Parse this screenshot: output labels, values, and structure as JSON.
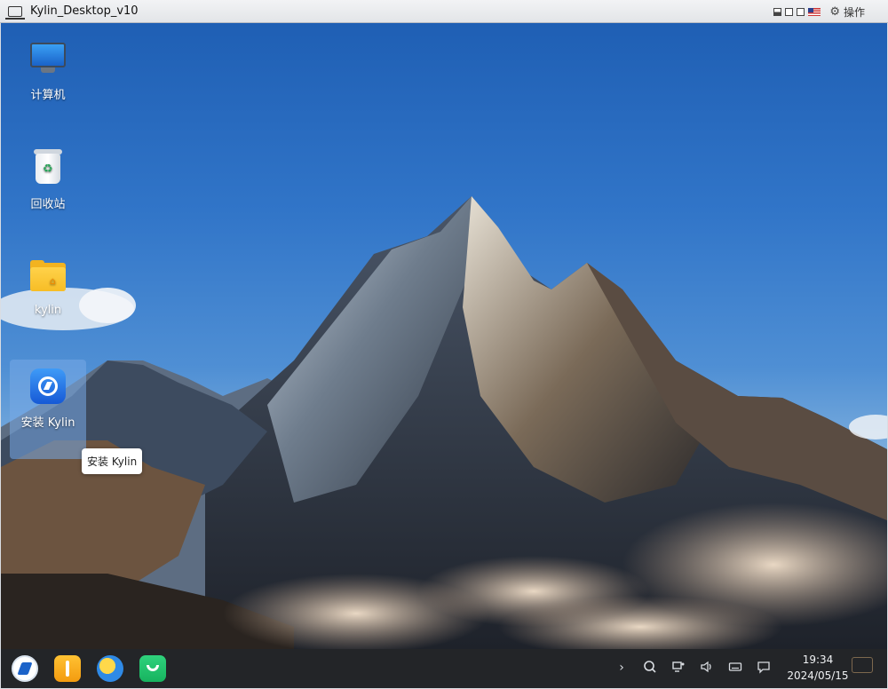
{
  "window": {
    "title": "Kylin_Desktop_v10",
    "ops_label": "操作",
    "icons": [
      "vm-icon",
      "restore-icon",
      "fit-icon",
      "fullscreen-icon",
      "flag-us-icon",
      "gear-icon"
    ]
  },
  "desktop": {
    "icons": [
      {
        "label": "计算机",
        "icon": "computer-icon"
      },
      {
        "label": "回收站",
        "icon": "trash-icon"
      },
      {
        "label": "kylin",
        "icon": "home-folder-icon"
      },
      {
        "label": "安装 Kylin",
        "icon": "installer-icon",
        "selected": true
      }
    ],
    "tooltip": "安装 Kylin"
  },
  "taskbar": {
    "apps": [
      "start-menu-icon",
      "file-manager-icon",
      "browser-icon",
      "software-store-icon"
    ],
    "tray": [
      "chevron-right-icon",
      "search-icon",
      "network-icon",
      "volume-icon",
      "keyboard-icon",
      "notification-icon"
    ],
    "time": "19:34",
    "date": "2024/05/15"
  },
  "colors": {
    "taskbar_bg": "#232528",
    "sky_top": "#1f5fb4",
    "selection": "#78aae6"
  }
}
